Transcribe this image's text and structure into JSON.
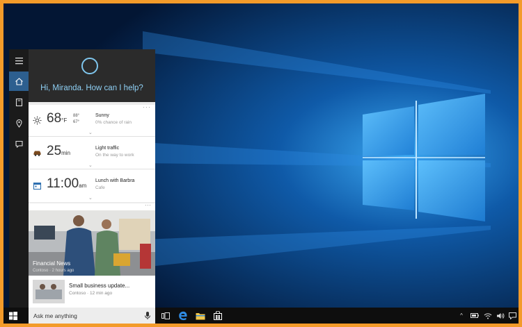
{
  "cortana": {
    "greeting": "Hi, Miranda. How can I help?",
    "cards": [
      {
        "type": "weather",
        "value": "68",
        "unit": "°F",
        "high": "88°",
        "low": "67°",
        "title": "Sunny",
        "subtitle": "0% chance of rain",
        "icon": "sun-icon"
      },
      {
        "type": "traffic",
        "value": "25",
        "unit": "min",
        "title": "Light traffic",
        "subtitle": "On the way to work",
        "icon": "car-icon"
      },
      {
        "type": "calendar",
        "value": "11:00",
        "unit": "am",
        "title": "Lunch with Barbra",
        "subtitle": "Cafe",
        "icon": "calendar-icon"
      }
    ],
    "card_more": "···",
    "news": {
      "caption": "Financial News",
      "caption_meta": "Contoso · 2 hours ago",
      "item_title": "Small business update...",
      "item_meta": "Contoso · 12 min ago"
    }
  },
  "rail": {
    "items": [
      "hamburger-icon",
      "home-icon",
      "notebook-icon",
      "location-icon",
      "feedback-icon"
    ]
  },
  "taskbar": {
    "search_placeholder": "Ask me anything",
    "pinned": [
      "task-view-icon",
      "edge-icon",
      "file-explorer-icon",
      "store-icon"
    ],
    "tray": {
      "chevron": "^"
    }
  },
  "colors": {
    "border": "#f39b2a",
    "accent": "#7fc6ee",
    "rail_active": "#2d5f8f"
  }
}
